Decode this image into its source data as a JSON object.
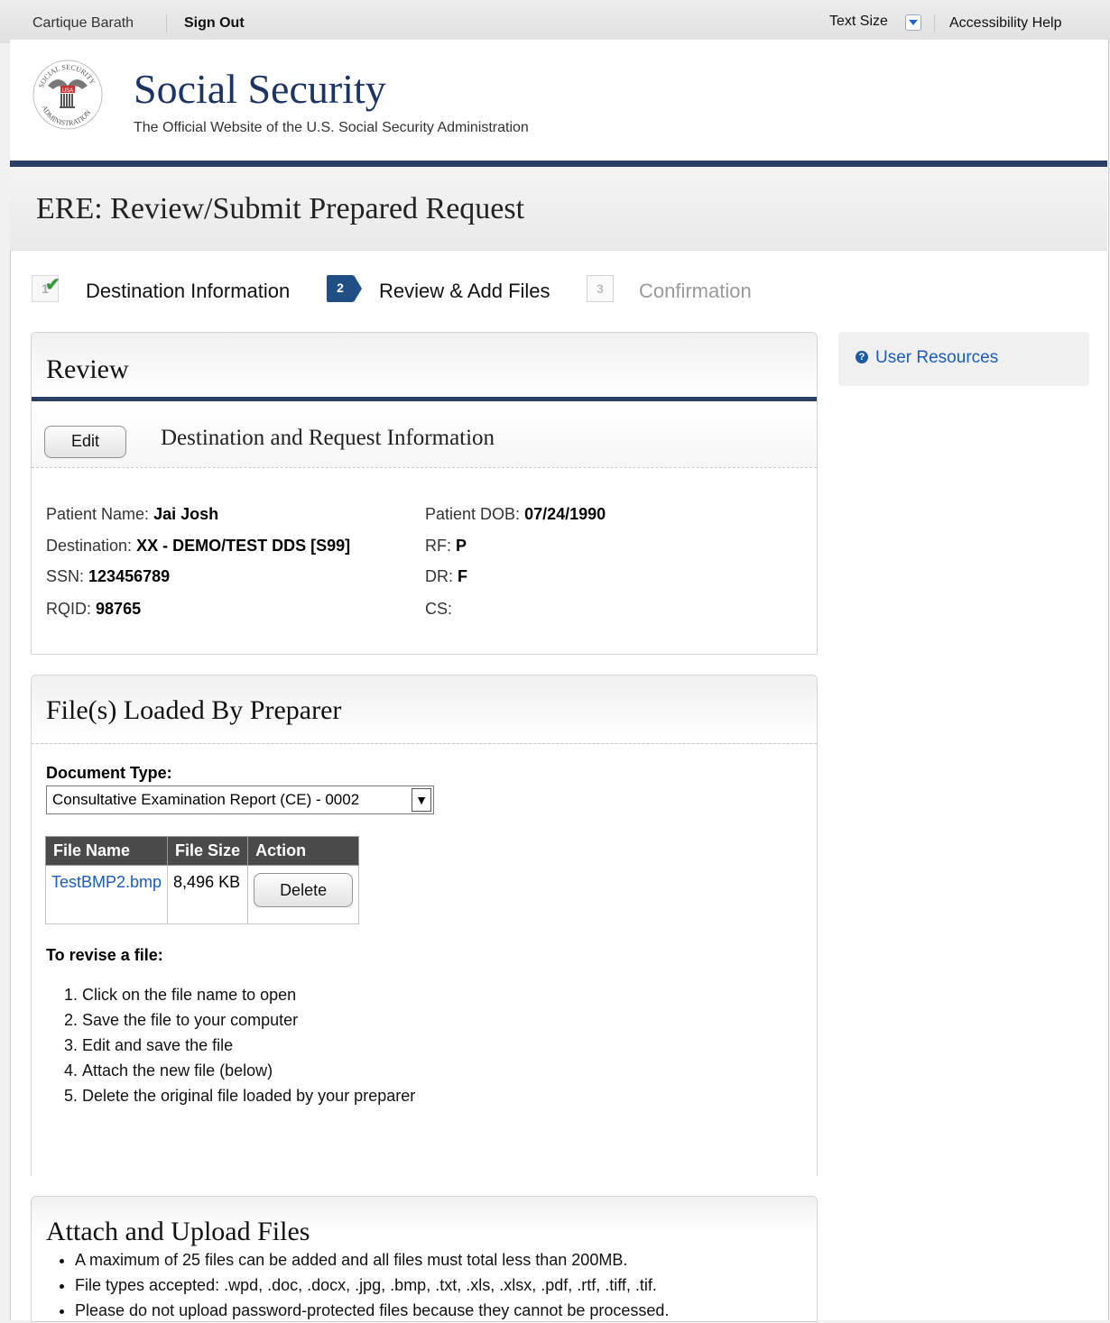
{
  "topbar": {
    "user_name": "Cartique Barath",
    "sign_out": "Sign Out",
    "text_size": "Text Size",
    "accessibility_help": "Accessibility Help"
  },
  "header": {
    "brand": "Social Security",
    "tagline": "The Official Website of the U.S. Social Security Administration",
    "seal_text": [
      "SOCIAL SECURITY",
      "ADMINISTRATION",
      "USA"
    ]
  },
  "page": {
    "title": "ERE: Review/Submit Prepared Request"
  },
  "steps": [
    {
      "number": "1",
      "label": "Destination Information",
      "state": "complete"
    },
    {
      "number": "2",
      "label": "Review & Add Files",
      "state": "current"
    },
    {
      "number": "3",
      "label": "Confirmation",
      "state": "upcoming"
    }
  ],
  "review": {
    "title": "Review",
    "edit_label": "Edit",
    "section_title": "Destination and Request Information",
    "fields": {
      "patient_name": {
        "label": "Patient Name:",
        "value": "Jai Josh"
      },
      "destination": {
        "label": "Destination:",
        "value": "XX - DEMO/TEST DDS [S99]"
      },
      "ssn": {
        "label": "SSN:",
        "value": "123456789"
      },
      "rqid": {
        "label": "RQID:",
        "value": "98765"
      },
      "patient_dob": {
        "label": "Patient DOB:",
        "value": "07/24/1990"
      },
      "rf": {
        "label": "RF:",
        "value": "P"
      },
      "dr": {
        "label": "DR:",
        "value": "F"
      },
      "cs": {
        "label": "CS:",
        "value": ""
      }
    }
  },
  "files_panel": {
    "title": "File(s) Loaded By Preparer",
    "doc_type_label": "Document Type:",
    "doc_type_selected": "Consultative Examination Report (CE) - 0002",
    "columns": [
      "File Name",
      "File Size",
      "Action"
    ],
    "rows": [
      {
        "file_name": "TestBMP2.bmp",
        "file_size": "8,496 KB",
        "action": "Delete"
      }
    ],
    "revise_heading": "To revise a file:",
    "revise_steps": [
      "Click on the file name to open",
      "Save the file to your computer",
      "Edit and save the file",
      "Attach the new file (below)",
      "Delete the original file loaded by your preparer"
    ]
  },
  "attach_panel": {
    "title": "Attach and Upload Files",
    "notes": [
      "A maximum of 25 files can be added and all files must total less than 200MB.",
      "File types accepted: .wpd, .doc, .docx, .jpg, .bmp, .txt, .xls, .xlsx, .pdf, .rtf, .tiff, .tif.",
      "Please do not upload password-protected files because they cannot be processed."
    ]
  },
  "sidebar": {
    "help_icon_glyph": "?",
    "user_resources": "User Resources"
  },
  "colors": {
    "navy_rule": "#2a3f63",
    "brand_text": "#1b3465",
    "link": "#1a5bbd",
    "step_active": "#1f4f84",
    "check_green": "#3d9a3a"
  }
}
